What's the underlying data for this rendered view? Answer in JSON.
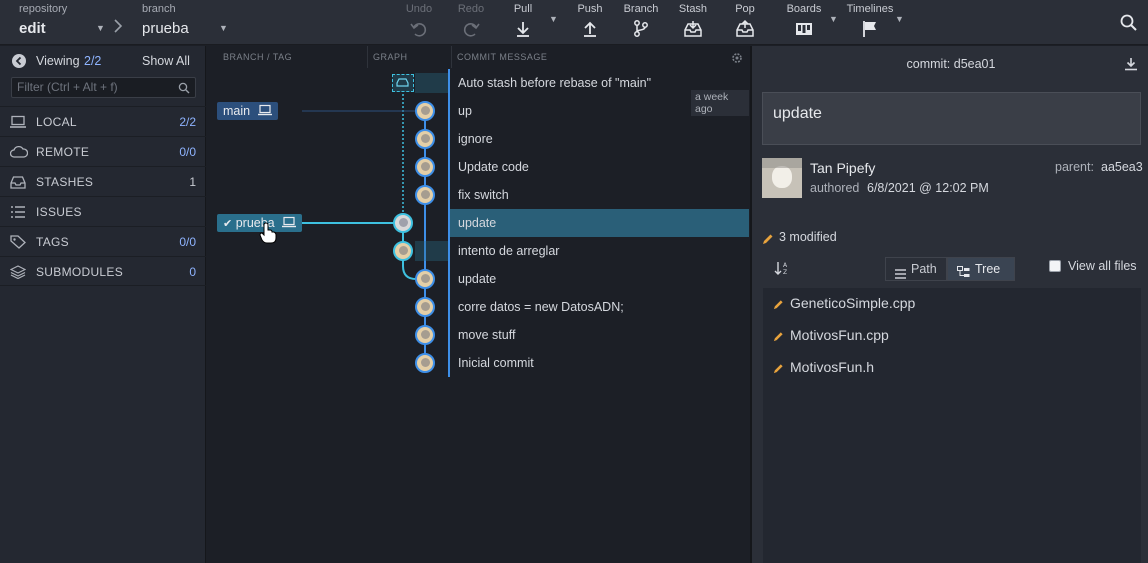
{
  "toolbar": {
    "repository_label": "repository",
    "repository_value": "edit",
    "branch_label": "branch",
    "branch_value": "prueba",
    "undo": "Undo",
    "redo": "Redo",
    "pull": "Pull",
    "push": "Push",
    "branch": "Branch",
    "stash": "Stash",
    "pop": "Pop",
    "boards": "Boards",
    "timelines": "Timelines"
  },
  "sidebar": {
    "viewing_label": "Viewing",
    "viewing_count": "2/2",
    "show_all": "Show All",
    "filter_placeholder": "Filter (Ctrl + Alt + f)",
    "sections": [
      {
        "label": "LOCAL",
        "count": "2/2",
        "icon": "laptop-icon"
      },
      {
        "label": "REMOTE",
        "count": "0/0",
        "icon": "cloud-icon"
      },
      {
        "label": "STASHES",
        "count": "1",
        "icon": "inbox-icon"
      },
      {
        "label": "ISSUES",
        "count": "",
        "icon": "list-icon"
      },
      {
        "label": "TAGS",
        "count": "0/0",
        "icon": "tag-icon"
      },
      {
        "label": "SUBMODULES",
        "count": "0",
        "icon": "layers-icon"
      }
    ]
  },
  "graph": {
    "headers": {
      "branch": "BRANCH / TAG",
      "graph": "GRAPH",
      "message": "COMMIT MESSAGE"
    },
    "time_badge": "a week ago",
    "branch_tags": [
      {
        "label": "main",
        "row": 1,
        "checked": false
      },
      {
        "label": "prueba",
        "row": 5,
        "checked": true
      }
    ],
    "commits": [
      {
        "message": "Auto stash before rebase of \"main\"",
        "stash": true
      },
      {
        "message": "up"
      },
      {
        "message": "ignore"
      },
      {
        "message": "Update code"
      },
      {
        "message": "fix switch"
      },
      {
        "message": "update",
        "selected": true
      },
      {
        "message": "intento de arreglar"
      },
      {
        "message": "update"
      },
      {
        "message": "corre datos = new DatosADN;"
      },
      {
        "message": "move stuff"
      },
      {
        "message": "Inicial commit"
      }
    ]
  },
  "detail": {
    "commit_label": "commit:",
    "commit_sha": "d5ea01",
    "summary": "update",
    "author": "Tan Pipefy",
    "authored_label": "authored",
    "authored_date": "6/8/2021 @ 12:02 PM",
    "parent_label": "parent:",
    "parent_sha": "aa5ea3",
    "modified_count": "3 modified",
    "path_label": "Path",
    "tree_label": "Tree",
    "view_all_files": "View all files",
    "files": [
      "GeneticoSimple.cpp",
      "MotivosFun.cpp",
      "MotivosFun.h"
    ]
  },
  "colors": {
    "accent_blue": "#3e8fe8",
    "selected_row": "#2a5f78",
    "prueba_tag": "#2a6f8c",
    "main_tag": "#2c4f7c"
  }
}
